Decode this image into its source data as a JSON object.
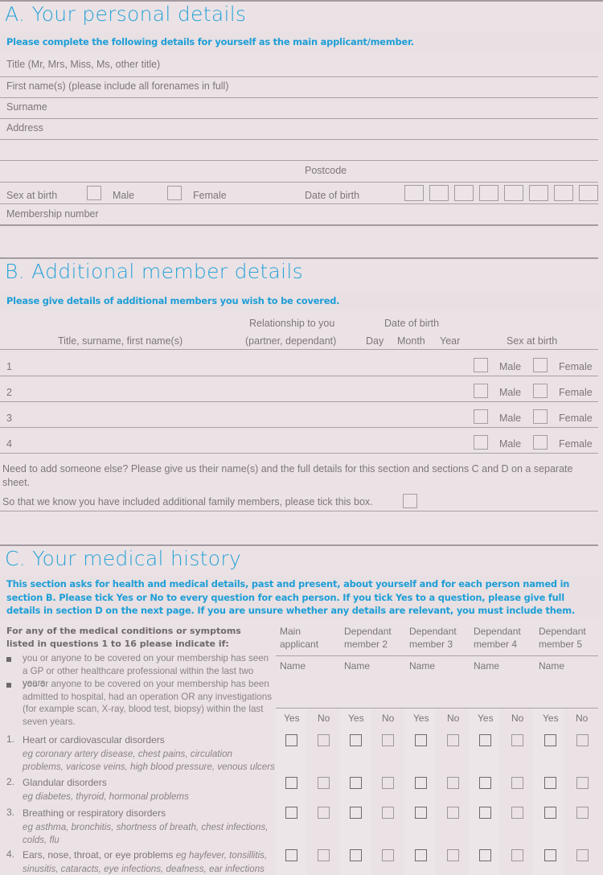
{
  "sectionA": {
    "title": "A.  Your personal details",
    "instruction": "Please complete the following details for yourself as the main applicant/member.",
    "fields": {
      "title": "Title (Mr, Mrs, Miss, Ms, other title)",
      "first_names": "First name(s) (please include all forenames in full)",
      "surname": "Surname",
      "address": "Address",
      "postcode": "Postcode",
      "sex_at_birth": "Sex at birth",
      "male": "Male",
      "female": "Female",
      "date_of_birth": "Date of birth",
      "membership_number": "Membership number"
    }
  },
  "sectionB": {
    "title": "B.  Additional member details",
    "instruction": "Please give details of additional members you wish to be covered.",
    "headers": {
      "name": "Title, surname, first name(s)",
      "relationship_line1": "Relationship to you",
      "relationship_line2": "(partner, dependant)",
      "dob": "Date of birth",
      "day": "Day",
      "month": "Month",
      "year": "Year",
      "sex": "Sex at birth"
    },
    "rows": [
      {
        "num": "1",
        "male": "Male",
        "female": "Female"
      },
      {
        "num": "2",
        "male": "Male",
        "female": "Female"
      },
      {
        "num": "3",
        "male": "Male",
        "female": "Female"
      },
      {
        "num": "4",
        "male": "Male",
        "female": "Female"
      }
    ],
    "note": "Need to add someone else? Please give us their name(s) and the full details for this section and sections C and D on a separate sheet.",
    "tick_note": "So that we know you have included additional family members, please tick this box."
  },
  "sectionC": {
    "title": "C.  Your medical history",
    "instruction": "This section asks for health and medical details, past and present, about yourself and for each person named in section B. Please tick Yes or No to every question for each person. If you tick Yes to a question, please give full details in section D on the next page. If you are unsure whether any details are relevant, you must include them.",
    "intro_bold": "For any of the medical conditions or symptoms listed in questions 1 to 16 please indicate if:",
    "bullets": [
      "you or anyone to be covered on your membership has seen a GP or other healthcare professional within the last two years",
      "you or anyone to be covered on your membership has been admitted to hospital, had an operation OR any investigations (for example scan, X-ray, blood test, biopsy) within the last seven years."
    ],
    "columns": [
      {
        "line1": "Main",
        "line2": "applicant",
        "name": "Name",
        "yes": "Yes",
        "no": "No"
      },
      {
        "line1": "Dependant",
        "line2": "member 2",
        "name": "Name",
        "yes": "Yes",
        "no": "No"
      },
      {
        "line1": "Dependant",
        "line2": "member 3",
        "name": "Name",
        "yes": "Yes",
        "no": "No"
      },
      {
        "line1": "Dependant",
        "line2": "member 4",
        "name": "Name",
        "yes": "Yes",
        "no": "No"
      },
      {
        "line1": "Dependant",
        "line2": "member 5",
        "name": "Name",
        "yes": "Yes",
        "no": "No"
      }
    ],
    "questions": [
      {
        "num": "1.",
        "title": "Heart or cardiovascular disorders",
        "eg": "eg coronary artery disease, chest pains, circulation problems, varicose veins, high blood pressure, venous ulcers"
      },
      {
        "num": "2.",
        "title": "Glandular disorders",
        "eg": "eg diabetes, thyroid, hormonal problems"
      },
      {
        "num": "3.",
        "title": "Breathing or respiratory disorders",
        "eg": "eg asthma, bronchitis, shortness of breath, chest infections, colds, flu"
      },
      {
        "num": "4.",
        "title": "Ears, nose, throat, or eye problems ",
        "eg": "eg hayfever, tonsillitis, sinusitis, cataracts, eye infections, deafness, ear infections"
      }
    ]
  }
}
